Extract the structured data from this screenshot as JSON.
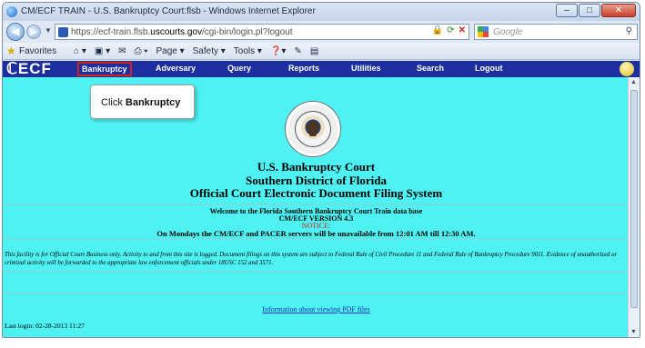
{
  "window": {
    "title": "CM/ECF TRAIN - U.S. Bankruptcy Court:flsb - Windows Internet Explorer",
    "controls": {
      "minimize": "–",
      "maximize": "□",
      "close": "✕"
    }
  },
  "addressbar": {
    "url_prefix": "https://ecf-train.flsb.",
    "url_domain": "uscourts.gov",
    "url_suffix": "/cgi-bin/login.pl?logout",
    "search_placeholder": "Google",
    "icons": [
      "back-icon",
      "forward-icon",
      "lock-icon",
      "refresh-icon",
      "stop-icon",
      "search-icon"
    ]
  },
  "favorites": {
    "label": "Favorites",
    "commands": [
      "Page ▾",
      "Safety ▾",
      "Tools ▾"
    ]
  },
  "ecf_nav": {
    "logo": "ECF",
    "menu": [
      "Bankruptcy",
      "Adversary",
      "Query",
      "Reports",
      "Utilities",
      "Search",
      "Logout"
    ]
  },
  "tooltip": {
    "prefix": "Click ",
    "emphasis": "Bankruptcy"
  },
  "court": {
    "line1": "U.S. Bankruptcy Court",
    "line2": "Southern District of Florida",
    "line3": "Official Court Electronic Document Filing System"
  },
  "welcome": {
    "line1": "Welcome to the Florida Southern Bankruptcy Court Train data base",
    "line2": "CM/ECF VERSION 4.3",
    "line3": "NOTICE:",
    "line4": "On Mondays the CM/ECF and PACER servers will be unavailable from 12:01 AM till 12:30 AM."
  },
  "notice": "This facility is for Official Court Business only. Activity to and from this site is logged. Document filings on this system are subject to Federal Rule of Civil Procedure 11 and Federal Rule of Bankruptcy Procedure 9011. Evidence of unauthorized or criminal activity will be forwarded to the appropriate law enforcement officials under 18USC 152 and 3571.",
  "pdf_link": "Information about viewing PDF files",
  "last_login": "Last login: 02-28-2013 11:27",
  "colors": {
    "content_bg": "#4ff2f2",
    "nav_bg": "#1d2f9e",
    "highlight": "#d32020"
  }
}
